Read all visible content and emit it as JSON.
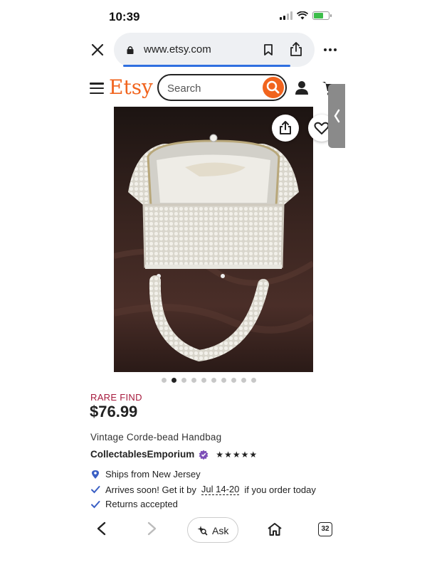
{
  "status_bar": {
    "time": "10:39"
  },
  "browser": {
    "url": "www.etsy.com",
    "tab_count": "32",
    "ask_label": "Ask"
  },
  "etsy": {
    "logo": "Etsy",
    "search_placeholder": "Search"
  },
  "carousel": {
    "total": 10,
    "active_index": 1
  },
  "listing": {
    "badge": "RARE FIND",
    "price": "$76.99",
    "title": "Vintage Corde-bead Handbag",
    "shop_name": "CollectablesEmporium",
    "rating_stars": 5,
    "ships_from": "Ships from New Jersey",
    "arrives_prefix": "Arrives soon! Get it by",
    "arrives_date": "Jul 14-20",
    "arrives_suffix": "if you order today",
    "returns": "Returns accepted"
  },
  "colors": {
    "etsy_orange": "#f1641e",
    "rare_find": "#a61a3d",
    "check_blue": "#3a5fc4"
  },
  "icons": [
    "close-icon",
    "lock-icon",
    "bookmark-icon",
    "share-icon",
    "more-icon",
    "menu-icon",
    "search-icon",
    "user-icon",
    "cart-icon",
    "heart-icon",
    "location-icon",
    "check-icon",
    "back-icon",
    "forward-icon",
    "sparkle-icon",
    "home-icon",
    "tabs-icon"
  ]
}
